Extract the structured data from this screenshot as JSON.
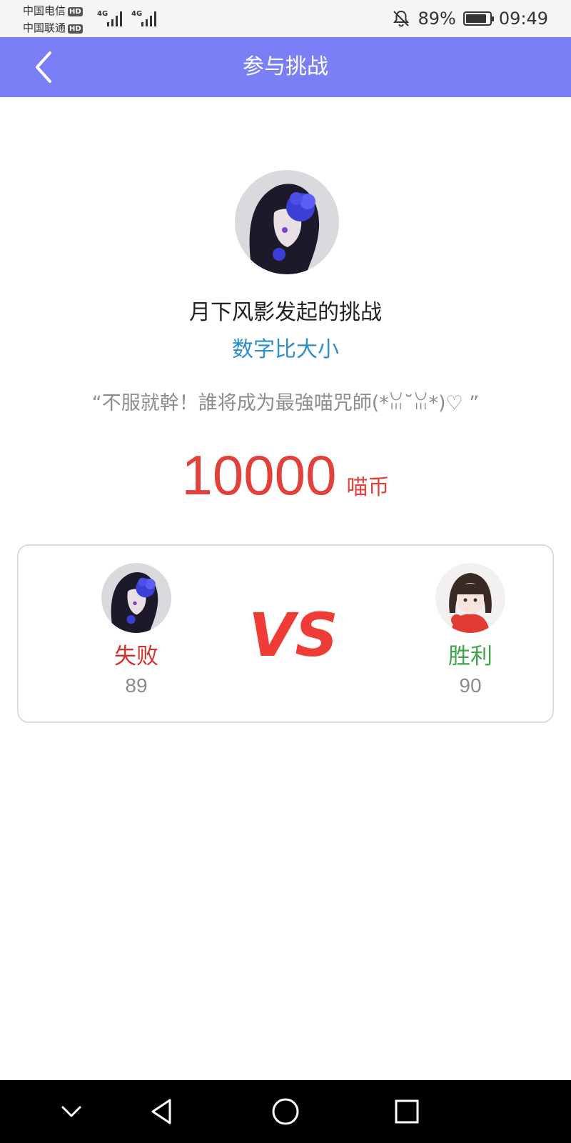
{
  "status_bar": {
    "carrier1": "中国电信",
    "carrier2": "中国联通",
    "hd_badge": "HD",
    "network1": "4G",
    "network2": "4G",
    "battery_percent": "89%",
    "battery_level": 0.89,
    "time": "09:49",
    "icons": [
      "hd-badge",
      "signal-icon",
      "mute-bell-icon",
      "battery-icon"
    ]
  },
  "header": {
    "title": "参与挑战",
    "back_icon": "chevron-left-icon",
    "bg_color": "#7b7ff5"
  },
  "challenge": {
    "title": "月下风影发起的挑战",
    "game": "数字比大小",
    "slogan": "“不服就幹！誰将成为最強喵咒師(*ꈍ˘ꈍ*)♡ ”",
    "prize_amount": "10000",
    "prize_unit": "喵币"
  },
  "battle": {
    "left_player": {
      "result": "失败",
      "score": "89"
    },
    "right_player": {
      "result": "胜利",
      "score": "90"
    },
    "vs_label": "VS"
  },
  "nav_bar": {
    "icons": [
      "chevron-down-icon",
      "back-triangle-icon",
      "home-circle-icon",
      "recents-square-icon"
    ]
  },
  "colors": {
    "accent": "#7b7ff5",
    "prize_red": "#e2403a",
    "lose_red": "#d3302e",
    "win_green": "#3ea34a",
    "game_blue": "#2b8ecf"
  }
}
